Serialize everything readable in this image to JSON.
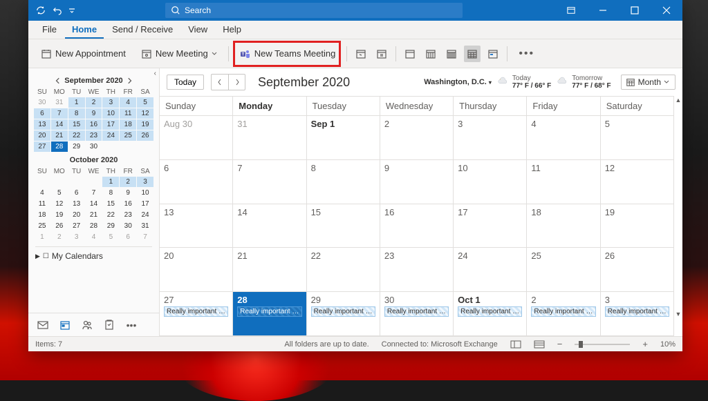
{
  "titlebar": {
    "search_placeholder": "Search"
  },
  "menu": {
    "file": "File",
    "home": "Home",
    "send_receive": "Send / Receive",
    "view": "View",
    "help": "Help"
  },
  "ribbon": {
    "new_appointment": "New Appointment",
    "new_meeting": "New Meeting",
    "new_teams_meeting": "New Teams Meeting"
  },
  "mini1": {
    "label": "September 2020",
    "dow": [
      "SU",
      "MO",
      "TU",
      "WE",
      "TH",
      "FR",
      "SA"
    ],
    "rows": [
      [
        {
          "n": "30",
          "c": "dim"
        },
        {
          "n": "31",
          "c": "dim"
        },
        {
          "n": "1",
          "c": "hl"
        },
        {
          "n": "2",
          "c": "hl"
        },
        {
          "n": "3",
          "c": "hl"
        },
        {
          "n": "4",
          "c": "hl"
        },
        {
          "n": "5",
          "c": "hl"
        }
      ],
      [
        {
          "n": "6",
          "c": "hl"
        },
        {
          "n": "7",
          "c": "hl"
        },
        {
          "n": "8",
          "c": "hl"
        },
        {
          "n": "9",
          "c": "hl"
        },
        {
          "n": "10",
          "c": "hl"
        },
        {
          "n": "11",
          "c": "hl"
        },
        {
          "n": "12",
          "c": "hl"
        }
      ],
      [
        {
          "n": "13",
          "c": "hl"
        },
        {
          "n": "14",
          "c": "hl"
        },
        {
          "n": "15",
          "c": "hl"
        },
        {
          "n": "16",
          "c": "hl"
        },
        {
          "n": "17",
          "c": "hl"
        },
        {
          "n": "18",
          "c": "hl"
        },
        {
          "n": "19",
          "c": "hl"
        }
      ],
      [
        {
          "n": "20",
          "c": "hl"
        },
        {
          "n": "21",
          "c": "hl"
        },
        {
          "n": "22",
          "c": "hl"
        },
        {
          "n": "23",
          "c": "hl"
        },
        {
          "n": "24",
          "c": "hl"
        },
        {
          "n": "25",
          "c": "hl"
        },
        {
          "n": "26",
          "c": "hl"
        }
      ],
      [
        {
          "n": "27",
          "c": "hl"
        },
        {
          "n": "28",
          "c": "today"
        },
        {
          "n": "29",
          "c": ""
        },
        {
          "n": "30",
          "c": ""
        },
        {
          "n": "",
          "c": ""
        },
        {
          "n": "",
          "c": ""
        },
        {
          "n": "",
          "c": ""
        }
      ]
    ]
  },
  "mini2": {
    "label": "October 2020",
    "dow": [
      "SU",
      "MO",
      "TU",
      "WE",
      "TH",
      "FR",
      "SA"
    ],
    "rows": [
      [
        {
          "n": "",
          "c": ""
        },
        {
          "n": "",
          "c": ""
        },
        {
          "n": "",
          "c": ""
        },
        {
          "n": "",
          "c": ""
        },
        {
          "n": "1",
          "c": "hl"
        },
        {
          "n": "2",
          "c": "hl"
        },
        {
          "n": "3",
          "c": "hl"
        }
      ],
      [
        {
          "n": "4",
          "c": ""
        },
        {
          "n": "5",
          "c": ""
        },
        {
          "n": "6",
          "c": ""
        },
        {
          "n": "7",
          "c": ""
        },
        {
          "n": "8",
          "c": ""
        },
        {
          "n": "9",
          "c": ""
        },
        {
          "n": "10",
          "c": ""
        }
      ],
      [
        {
          "n": "11",
          "c": ""
        },
        {
          "n": "12",
          "c": ""
        },
        {
          "n": "13",
          "c": ""
        },
        {
          "n": "14",
          "c": ""
        },
        {
          "n": "15",
          "c": ""
        },
        {
          "n": "16",
          "c": ""
        },
        {
          "n": "17",
          "c": ""
        }
      ],
      [
        {
          "n": "18",
          "c": ""
        },
        {
          "n": "19",
          "c": ""
        },
        {
          "n": "20",
          "c": ""
        },
        {
          "n": "21",
          "c": ""
        },
        {
          "n": "22",
          "c": ""
        },
        {
          "n": "23",
          "c": ""
        },
        {
          "n": "24",
          "c": ""
        }
      ],
      [
        {
          "n": "25",
          "c": ""
        },
        {
          "n": "26",
          "c": "bold"
        },
        {
          "n": "27",
          "c": ""
        },
        {
          "n": "28",
          "c": ""
        },
        {
          "n": "29",
          "c": ""
        },
        {
          "n": "30",
          "c": ""
        },
        {
          "n": "31",
          "c": ""
        }
      ],
      [
        {
          "n": "1",
          "c": "dim"
        },
        {
          "n": "2",
          "c": "dim"
        },
        {
          "n": "3",
          "c": "dim"
        },
        {
          "n": "4",
          "c": "dim"
        },
        {
          "n": "5",
          "c": "dim"
        },
        {
          "n": "6",
          "c": "dim"
        },
        {
          "n": "7",
          "c": "dim"
        }
      ]
    ]
  },
  "my_calendars": "My Calendars",
  "today_btn": "Today",
  "month_label": "September 2020",
  "location": "Washington, D.C.",
  "weather": {
    "today_label": "Today",
    "today_temp": "77° F / 66° F",
    "tomorrow_label": "Tomorrow",
    "tomorrow_temp": "77° F / 68° F"
  },
  "view_mode": "Month",
  "dow": [
    "Sunday",
    "Monday",
    "Tuesday",
    "Wednesday",
    "Thursday",
    "Friday",
    "Saturday"
  ],
  "weeks": [
    [
      {
        "n": "Aug 30",
        "c": "dim"
      },
      {
        "n": "31",
        "c": "dim"
      },
      {
        "n": "Sep 1",
        "c": "bold"
      },
      {
        "n": "2",
        "c": ""
      },
      {
        "n": "3",
        "c": ""
      },
      {
        "n": "4",
        "c": ""
      },
      {
        "n": "5",
        "c": ""
      }
    ],
    [
      {
        "n": "6",
        "c": ""
      },
      {
        "n": "7",
        "c": ""
      },
      {
        "n": "8",
        "c": ""
      },
      {
        "n": "9",
        "c": ""
      },
      {
        "n": "10",
        "c": ""
      },
      {
        "n": "11",
        "c": ""
      },
      {
        "n": "12",
        "c": ""
      }
    ],
    [
      {
        "n": "13",
        "c": ""
      },
      {
        "n": "14",
        "c": ""
      },
      {
        "n": "15",
        "c": ""
      },
      {
        "n": "16",
        "c": ""
      },
      {
        "n": "17",
        "c": ""
      },
      {
        "n": "18",
        "c": ""
      },
      {
        "n": "19",
        "c": ""
      }
    ],
    [
      {
        "n": "20",
        "c": ""
      },
      {
        "n": "21",
        "c": ""
      },
      {
        "n": "22",
        "c": ""
      },
      {
        "n": "23",
        "c": ""
      },
      {
        "n": "24",
        "c": ""
      },
      {
        "n": "25",
        "c": ""
      },
      {
        "n": "26",
        "c": ""
      }
    ],
    [
      {
        "n": "27",
        "c": "",
        "e": "Really important m..."
      },
      {
        "n": "28",
        "c": "selected bold",
        "e": "Really important m..."
      },
      {
        "n": "29",
        "c": "",
        "e": "Really important m..."
      },
      {
        "n": "30",
        "c": "",
        "e": "Really important m..."
      },
      {
        "n": "Oct 1",
        "c": "bold",
        "e": "Really important m..."
      },
      {
        "n": "2",
        "c": "",
        "e": "Really important m..."
      },
      {
        "n": "3",
        "c": "",
        "e": "Really important m..."
      }
    ]
  ],
  "status": {
    "items": "Items: 7",
    "folders": "All folders are up to date.",
    "connected": "Connected to: Microsoft Exchange",
    "zoom": "10%"
  }
}
